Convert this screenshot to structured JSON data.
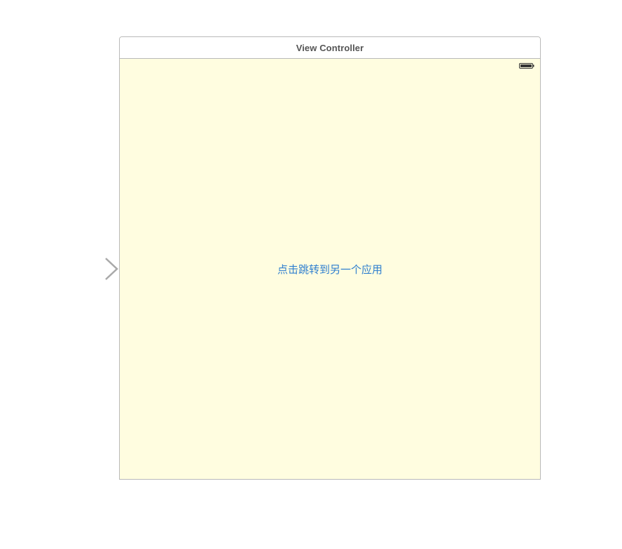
{
  "scene": {
    "title": "View Controller",
    "background_color": "#fffde0",
    "battery_icon": "battery-full-icon",
    "button_label": "点击跳转到另一个应用",
    "button_color": "#2f7fcf"
  },
  "canvas": {
    "entry_arrow_icon": "entry-point-arrow-icon"
  }
}
